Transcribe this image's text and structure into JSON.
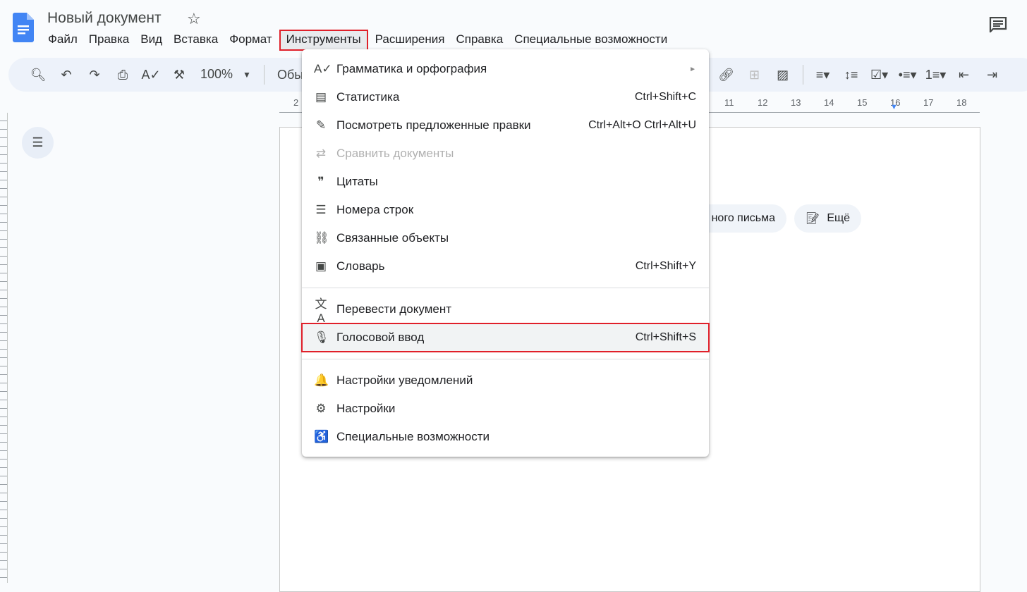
{
  "doc": {
    "title": "Новый документ"
  },
  "menubar": [
    "Файл",
    "Правка",
    "Вид",
    "Вставка",
    "Формат",
    "Инструменты",
    "Расширения",
    "Справка",
    "Специальные возможности"
  ],
  "toolbar": {
    "zoom": "100%",
    "style": "Обыч"
  },
  "ruler": [
    "2",
    "11",
    "12",
    "13",
    "14",
    "15",
    "16",
    "17",
    "18"
  ],
  "chips": {
    "partial": "ного письма",
    "more": "Ещё"
  },
  "menu": {
    "group1": [
      {
        "icon": "spellcheck-icon",
        "glyph": "A✓",
        "label": "Грамматика и орфография",
        "shortcut": "►"
      },
      {
        "icon": "word-count-icon",
        "glyph": "▤",
        "label": "Статистика",
        "shortcut": "Ctrl+Shift+C"
      },
      {
        "icon": "review-edits-icon",
        "glyph": "✎",
        "label": "Посмотреть предложенные правки",
        "shortcut": "Ctrl+Alt+O Ctrl+Alt+U"
      },
      {
        "icon": "compare-icon",
        "glyph": "⇄",
        "label": "Сравнить документы",
        "shortcut": ""
      },
      {
        "icon": "quote-icon",
        "glyph": "❞",
        "label": "Цитаты",
        "shortcut": ""
      },
      {
        "icon": "line-numbers-icon",
        "glyph": "☰",
        "label": "Номера строк",
        "shortcut": ""
      },
      {
        "icon": "linked-objects-icon",
        "glyph": "⛓",
        "label": "Связанные объекты",
        "shortcut": ""
      },
      {
        "icon": "dictionary-icon",
        "glyph": "▣",
        "label": "Словарь",
        "shortcut": "Ctrl+Shift+Y"
      }
    ],
    "group2": [
      {
        "icon": "translate-icon",
        "glyph": "文A",
        "label": "Перевести документ",
        "shortcut": ""
      },
      {
        "icon": "microphone-icon",
        "glyph": "🎙",
        "label": "Голосовой ввод",
        "shortcut": "Ctrl+Shift+S"
      }
    ],
    "group3": [
      {
        "icon": "bell-icon",
        "glyph": "🔔",
        "label": "Настройки уведомлений",
        "shortcut": ""
      },
      {
        "icon": "preferences-icon",
        "glyph": "⚙",
        "label": "Настройки",
        "shortcut": ""
      },
      {
        "icon": "accessibility-icon",
        "glyph": "♿",
        "label": "Специальные возможности",
        "shortcut": ""
      }
    ]
  }
}
